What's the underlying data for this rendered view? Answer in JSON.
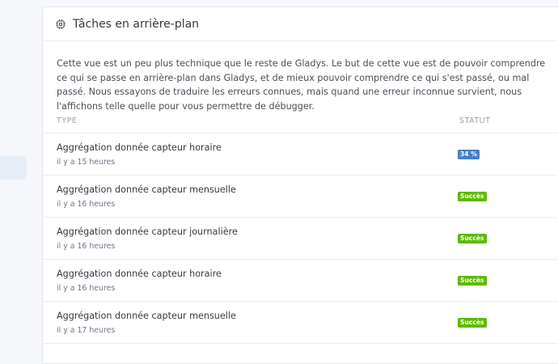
{
  "header": {
    "title": "Tâches en arrière-plan",
    "icon": "cpu-icon"
  },
  "intro": "Cette vue est un peu plus technique que le reste de Gladys. Le but de cette vue est de pouvoir comprendre ce qui se passe en arrière-plan dans Gladys, et de mieux pouvoir comprendre ce qui s'est passé, ou mal passé. Nous essayons de traduire les erreurs connues, mais quand une erreur inconnue survient, nous l'affichons telle quelle pour vous permettre de débugger.",
  "table": {
    "columns": {
      "type": "TYPE",
      "status": "STATUT"
    },
    "rows": [
      {
        "name": "Aggrégation donnée capteur horaire",
        "time": "il y a 15 heures",
        "status": "34 %",
        "status_color": "#467fcf"
      },
      {
        "name": "Aggrégation donnée capteur mensuelle",
        "time": "il y a 16 heures",
        "status": "Succès",
        "status_color": "#5eba00"
      },
      {
        "name": "Aggrégation donnée capteur journalière",
        "time": "il y a 16 heures",
        "status": "Succès",
        "status_color": "#5eba00"
      },
      {
        "name": "Aggrégation donnée capteur horaire",
        "time": "il y a 16 heures",
        "status": "Succès",
        "status_color": "#5eba00"
      },
      {
        "name": "Aggrégation donnée capteur mensuelle",
        "time": "il y a 17 heures",
        "status": "Succès",
        "status_color": "#5eba00"
      }
    ]
  }
}
